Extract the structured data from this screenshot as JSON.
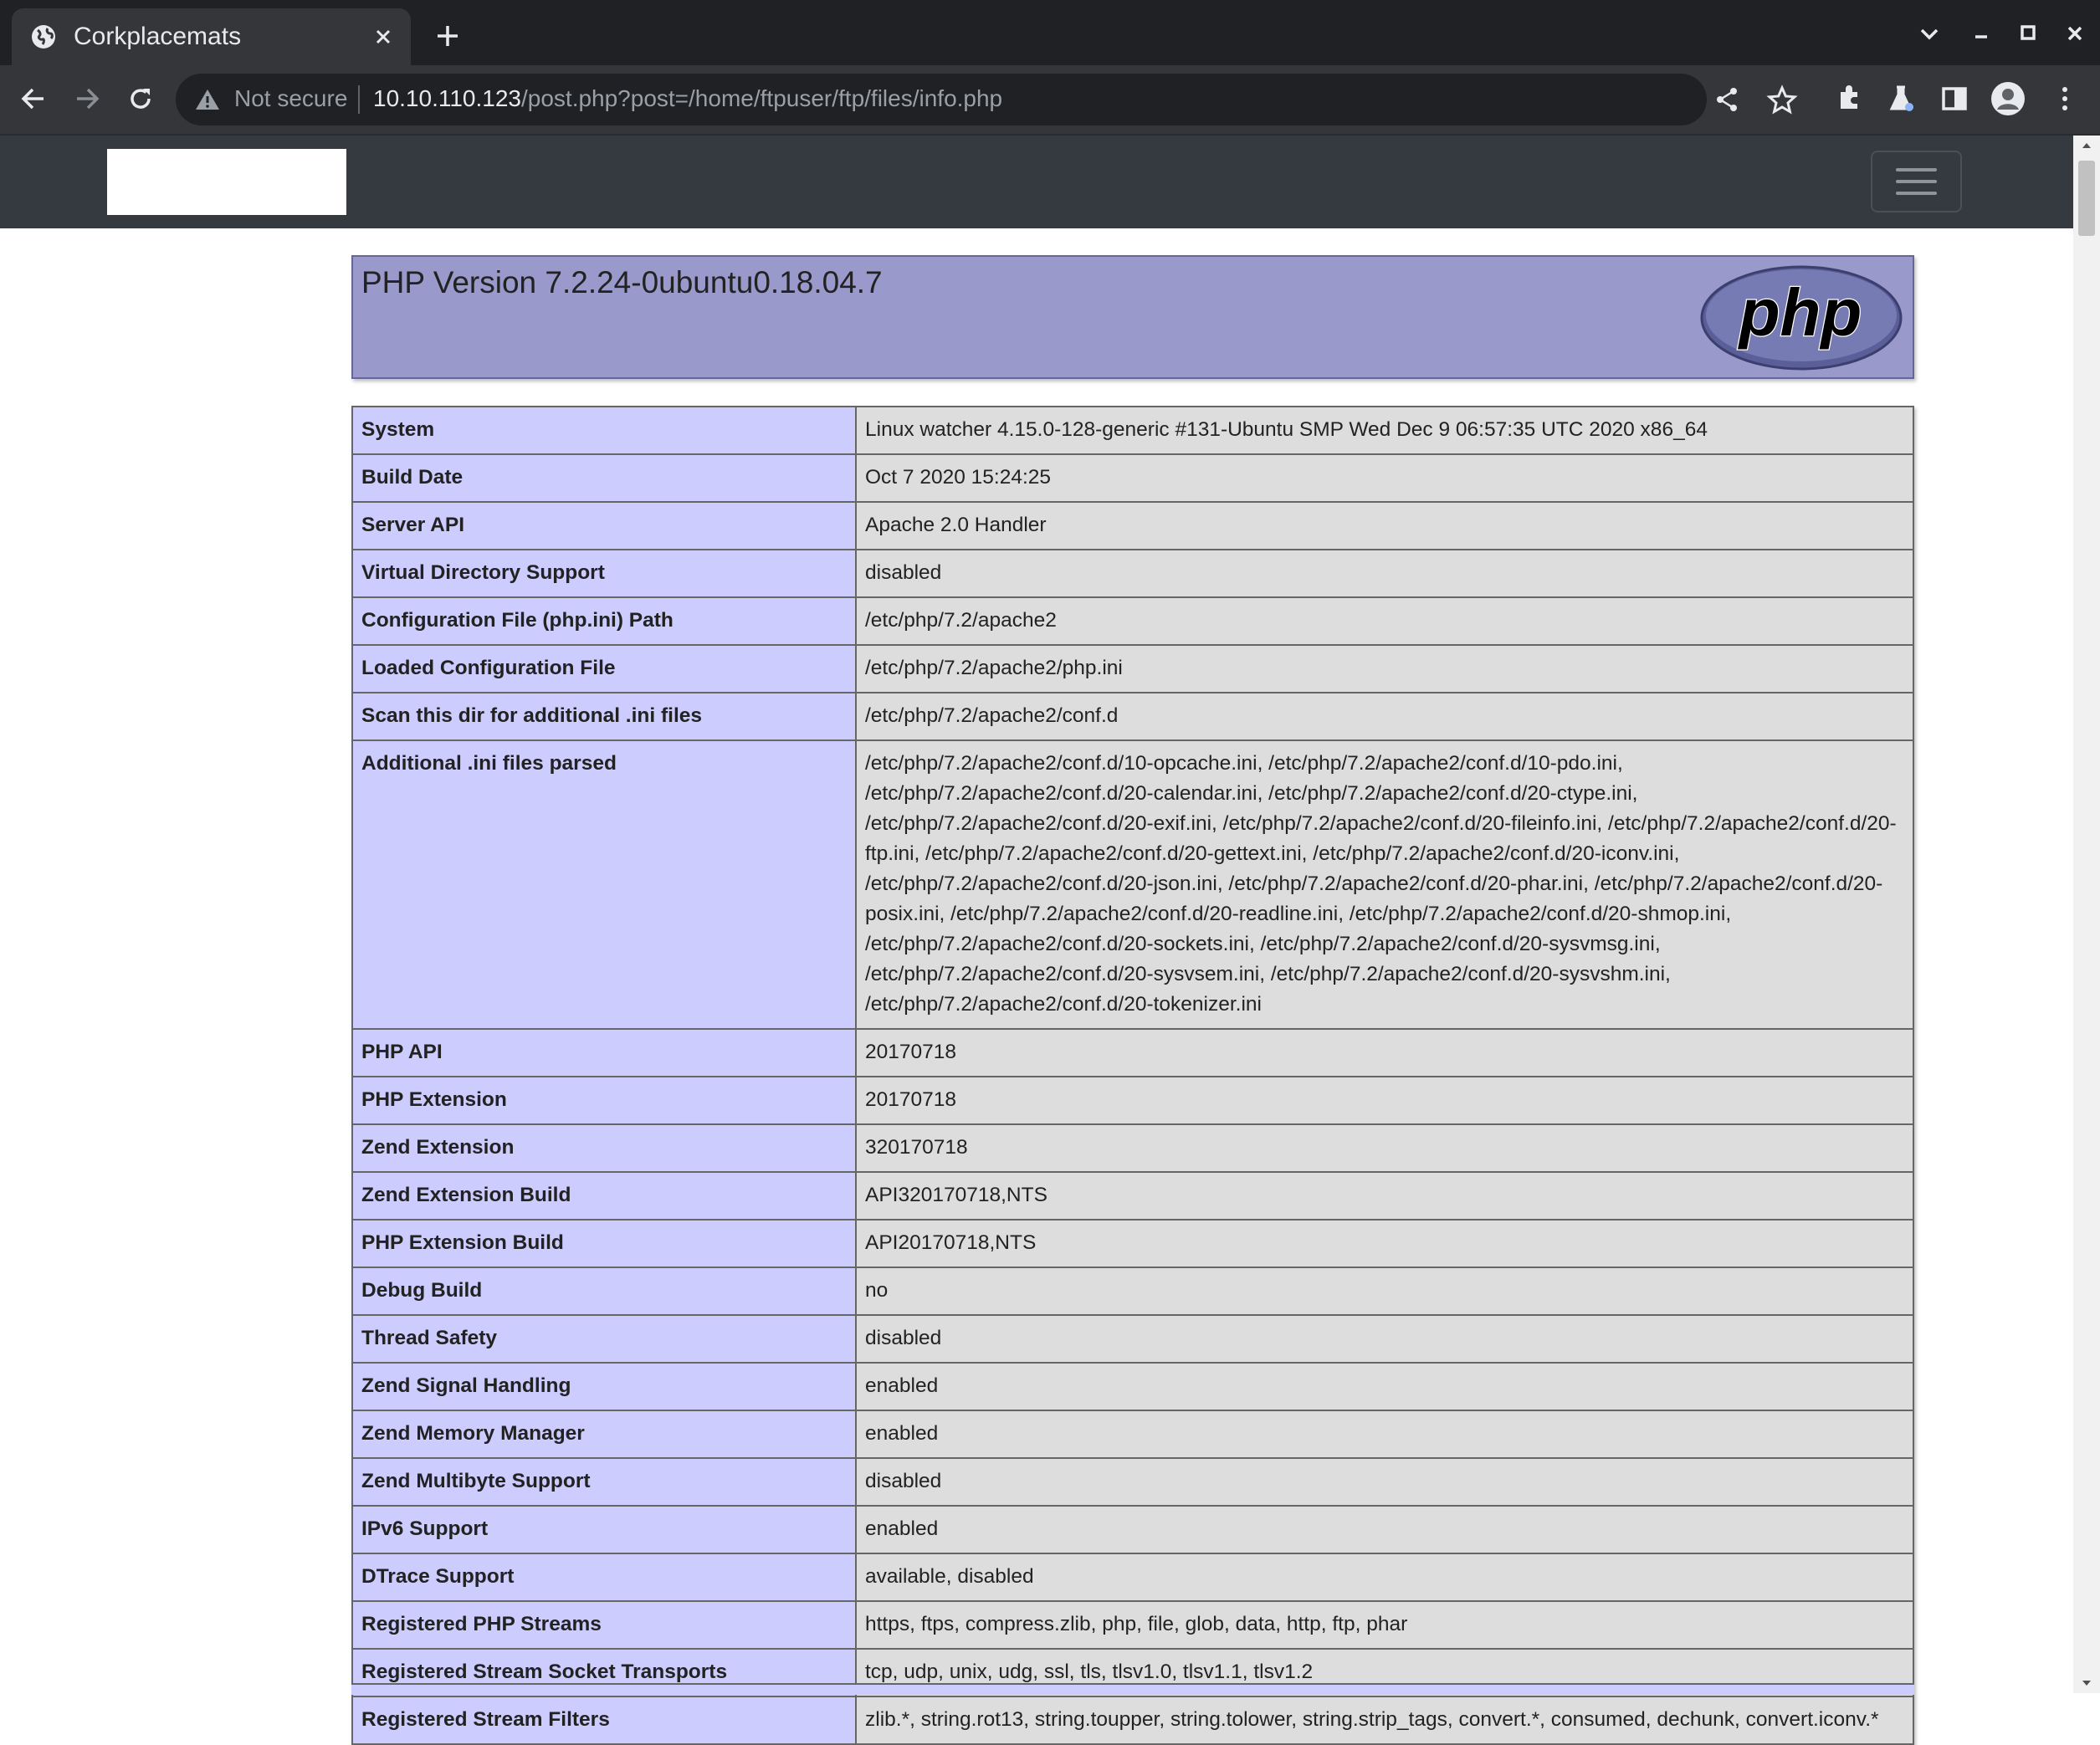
{
  "browser": {
    "tab_title": "Corkplacemats",
    "security_label": "Not secure",
    "url_host": "10.10.110.123",
    "url_path": "/post.php?post=/home/ftpuser/ftp/files/info.php",
    "icons": [
      "globe-icon",
      "close-icon",
      "plus-icon",
      "chevron-down-icon",
      "minimize-icon",
      "maximize-icon",
      "window-close-icon",
      "back-icon",
      "forward-icon",
      "reload-icon",
      "warning-icon",
      "share-icon",
      "star-icon",
      "extensions-icon",
      "labs-icon",
      "side-panel-icon",
      "profile-icon",
      "menu-icon"
    ]
  },
  "page": {
    "php_version": "PHP Version 7.2.24-0ubuntu0.18.04.7",
    "rows": [
      {
        "key": "System",
        "value": "Linux watcher 4.15.0-128-generic #131-Ubuntu SMP Wed Dec 9 06:57:35 UTC 2020 x86_64"
      },
      {
        "key": "Build Date",
        "value": "Oct 7 2020 15:24:25"
      },
      {
        "key": "Server API",
        "value": "Apache 2.0 Handler"
      },
      {
        "key": "Virtual Directory Support",
        "value": "disabled"
      },
      {
        "key": "Configuration File (php.ini) Path",
        "value": "/etc/php/7.2/apache2"
      },
      {
        "key": "Loaded Configuration File",
        "value": "/etc/php/7.2/apache2/php.ini"
      },
      {
        "key": "Scan this dir for additional .ini files",
        "value": "/etc/php/7.2/apache2/conf.d"
      },
      {
        "key": "Additional .ini files parsed",
        "value": "/etc/php/7.2/apache2/conf.d/10-opcache.ini, /etc/php/7.2/apache2/conf.d/10-pdo.ini, /etc/php/7.2/apache2/conf.d/20-calendar.ini, /etc/php/7.2/apache2/conf.d/20-ctype.ini, /etc/php/7.2/apache2/conf.d/20-exif.ini, /etc/php/7.2/apache2/conf.d/20-fileinfo.ini, /etc/php/7.2/apache2/conf.d/20-ftp.ini, /etc/php/7.2/apache2/conf.d/20-gettext.ini, /etc/php/7.2/apache2/conf.d/20-iconv.ini, /etc/php/7.2/apache2/conf.d/20-json.ini, /etc/php/7.2/apache2/conf.d/20-phar.ini, /etc/php/7.2/apache2/conf.d/20-posix.ini, /etc/php/7.2/apache2/conf.d/20-readline.ini, /etc/php/7.2/apache2/conf.d/20-shmop.ini, /etc/php/7.2/apache2/conf.d/20-sockets.ini, /etc/php/7.2/apache2/conf.d/20-sysvmsg.ini, /etc/php/7.2/apache2/conf.d/20-sysvsem.ini, /etc/php/7.2/apache2/conf.d/20-sysvshm.ini, /etc/php/7.2/apache2/conf.d/20-tokenizer.ini"
      },
      {
        "key": "PHP API",
        "value": "20170718"
      },
      {
        "key": "PHP Extension",
        "value": "20170718"
      },
      {
        "key": "Zend Extension",
        "value": "320170718"
      },
      {
        "key": "Zend Extension Build",
        "value": "API320170718,NTS"
      },
      {
        "key": "PHP Extension Build",
        "value": "API20170718,NTS"
      },
      {
        "key": "Debug Build",
        "value": "no"
      },
      {
        "key": "Thread Safety",
        "value": "disabled"
      },
      {
        "key": "Zend Signal Handling",
        "value": "enabled"
      },
      {
        "key": "Zend Memory Manager",
        "value": "enabled"
      },
      {
        "key": "Zend Multibyte Support",
        "value": "disabled"
      },
      {
        "key": "IPv6 Support",
        "value": "enabled"
      },
      {
        "key": "DTrace Support",
        "value": "available, disabled"
      },
      {
        "key": "Registered PHP Streams",
        "value": "https, ftps, compress.zlib, php, file, glob, data, http, ftp, phar"
      },
      {
        "key": "Registered Stream Socket Transports",
        "value": "tcp, udp, unix, udg, ssl, tls, tlsv1.0, tlsv1.1, tlsv1.2"
      },
      {
        "key": "Registered Stream Filters",
        "value": "zlib.*, string.rot13, string.toupper, string.tolower, string.strip_tags, convert.*, consumed, dechunk, convert.iconv.*"
      }
    ]
  },
  "colors": {
    "header_bg": "#9999cc",
    "key_cell_bg": "#ccccff",
    "value_cell_bg": "#dddddd",
    "navbar_bg": "#343a40",
    "chrome_bg": "#202124",
    "toolbar_bg": "#35363a"
  }
}
